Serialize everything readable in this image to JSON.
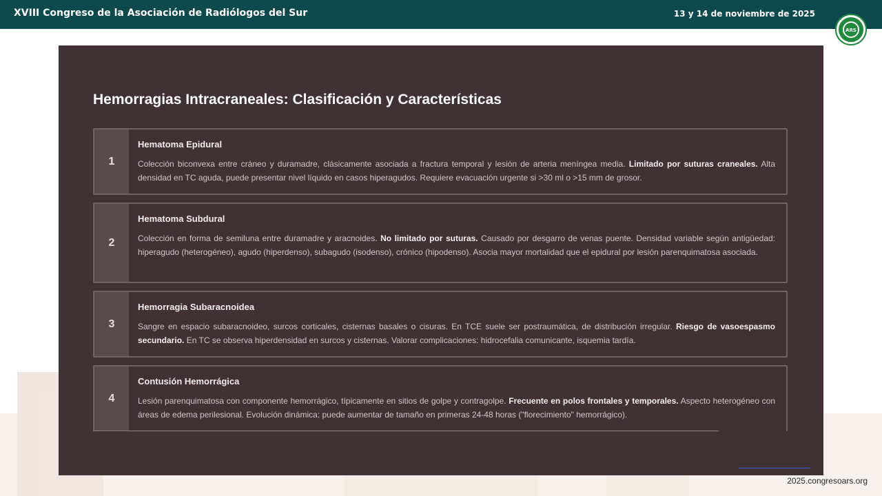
{
  "header": {
    "title": "XVIII Congreso de la Asociación de Radiólogos del Sur",
    "date": "13 y 14 de noviembre de 2025",
    "logo_text": "ARS",
    "logo_ring_text_top": "ASOCIACIÓN RADIÓLOGOS",
    "logo_ring_text_bottom": "SUR"
  },
  "slide": {
    "title": "Hemorragias Intracraneales: Clasificación y Características",
    "cards": [
      {
        "number": "1",
        "heading": "Hematoma Epidural",
        "text_before": "Colección biconvexa entre cráneo y duramadre, clásicamente asociada a fractura temporal y lesión de arteria meníngea media.",
        "bold": "Limitado por suturas craneales.",
        "text_after": "Alta densidad en TC aguda, puede presentar nivel líquido en casos hiperagudos. Requiere evacuación urgente si >30 ml o >15 mm de grosor."
      },
      {
        "number": "2",
        "heading": "Hematoma Subdural",
        "text_before": "Colección en forma de semiluna entre duramadre y aracnoides.",
        "bold": "No limitado por suturas.",
        "text_after": "Causado por desgarro de venas puente. Densidad variable según antigüedad: hiperagudo (heterogéneo), agudo (hiperdenso), subagudo (isodenso), crónico (hipodenso). Asocia mayor mortalidad que el epidural por lesión parenquimatosa asociada."
      },
      {
        "number": "3",
        "heading": "Hemorragia Subaracnoidea",
        "text_before": "Sangre en espacio subaracnoideo, surcos corticales, cisternas basales o cisuras. En TCE suele ser postraumática, de distribución irregular.",
        "bold": "Riesgo de vasoespasmo secundario.",
        "text_after": "En TC se observa hiperdensidad en surcos y cisternas. Valorar complicaciones: hidrocefalia comunicante, isquemia tardía."
      },
      {
        "number": "4",
        "heading": "Contusión Hemorrágica",
        "text_before": "Lesión parenquimatosa con componente hemorrágico, típicamente en sitios de golpe y contragolpe.",
        "bold": "Frecuente en polos frontales y temporales.",
        "text_after": "Aspecto heterogéneo con áreas de edema perilesional. Evolución dinámica: puede aumentar de tamaño en primeras 24-48 horas (\"florecimiento\" hemorrágico)."
      }
    ]
  },
  "footer": {
    "url": "2025.congresoars.org"
  },
  "colors": {
    "header_bg": "#0e4a4d",
    "slide_bg": "#3f3134",
    "card_number_bg": "#5a4a4d",
    "logo_green": "#1f8a3b"
  }
}
